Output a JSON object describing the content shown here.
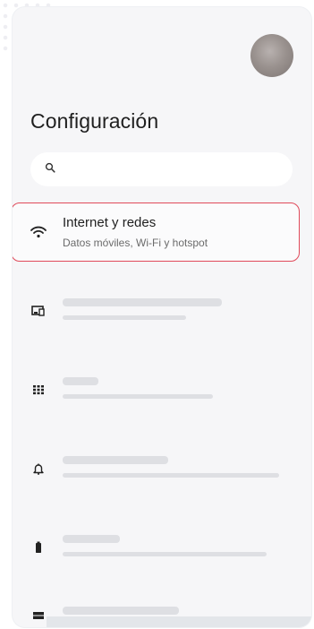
{
  "header": {
    "title": "Configuración"
  },
  "search": {
    "placeholder": "",
    "value": "",
    "icon": "search-icon"
  },
  "avatar": {
    "icon": "avatar"
  },
  "settings_items": [
    {
      "icon": "wifi-icon",
      "title": "Internet y redes",
      "subtitle": "Datos móviles, Wi-Fi y hotspot",
      "highlighted": true
    },
    {
      "icon": "devices-icon",
      "loading": true
    },
    {
      "icon": "apps-grid-icon",
      "loading": true
    },
    {
      "icon": "bell-icon",
      "loading": true
    },
    {
      "icon": "battery-icon",
      "loading": true
    },
    {
      "icon": "storage-icon",
      "loading": true
    }
  ],
  "colors": {
    "highlight_border": "#e04a5a",
    "skeleton": "#dedfe3",
    "background": "#f6f6f8"
  }
}
